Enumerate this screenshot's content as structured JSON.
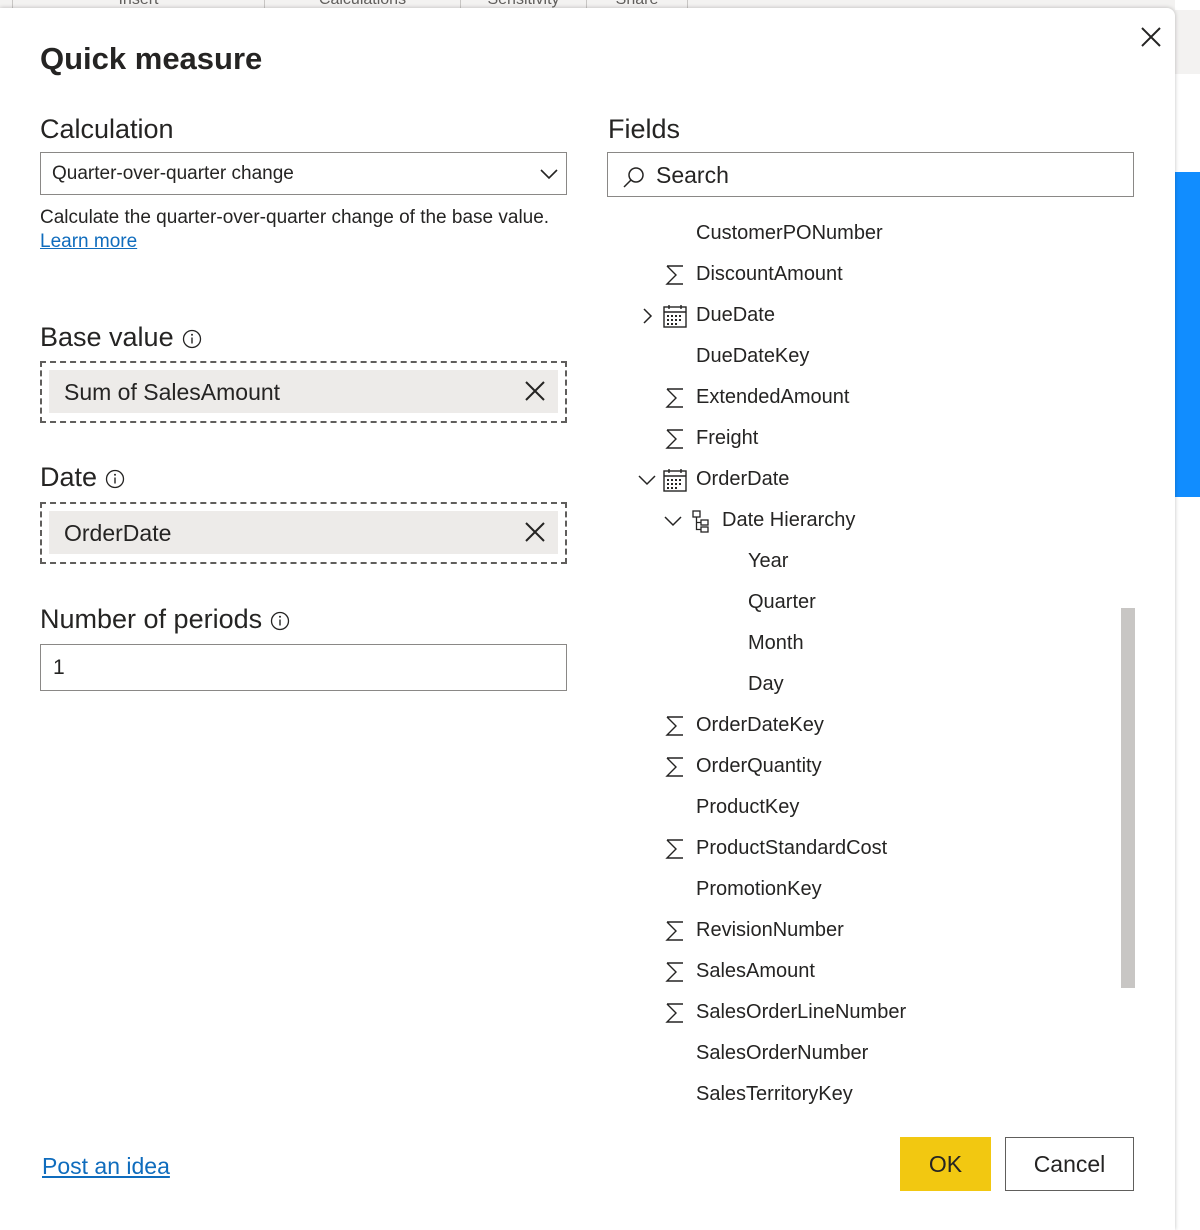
{
  "ribbon": {
    "tabs": [
      "Insert",
      "Calculations",
      "Sensitivity",
      "Share"
    ]
  },
  "dialog": {
    "title": "Quick measure",
    "calculation": {
      "label": "Calculation",
      "selected": "Quarter-over-quarter change",
      "description": "Calculate the quarter-over-quarter change of the base value.",
      "learn_more": "Learn more"
    },
    "base_value": {
      "label": "Base value",
      "chip": "Sum of SalesAmount"
    },
    "date": {
      "label": "Date",
      "chip": "OrderDate"
    },
    "periods": {
      "label": "Number of periods",
      "value": "1"
    },
    "fields": {
      "label": "Fields",
      "search_placeholder": "Search",
      "items": [
        {
          "label": "CustomerPONumber",
          "icon": "none"
        },
        {
          "label": "DiscountAmount",
          "icon": "sigma-icon"
        },
        {
          "label": "DueDate",
          "icon": "calendar-icon",
          "expand": "collapsed"
        },
        {
          "label": "DueDateKey",
          "icon": "none"
        },
        {
          "label": "ExtendedAmount",
          "icon": "sigma-icon"
        },
        {
          "label": "Freight",
          "icon": "sigma-icon"
        },
        {
          "label": "OrderDate",
          "icon": "calendar-icon",
          "expand": "expanded"
        },
        {
          "label": "Date Hierarchy",
          "icon": "hierarchy-icon",
          "expand": "expanded"
        },
        {
          "label": "Year",
          "icon": "none"
        },
        {
          "label": "Quarter",
          "icon": "none"
        },
        {
          "label": "Month",
          "icon": "none"
        },
        {
          "label": "Day",
          "icon": "none"
        },
        {
          "label": "OrderDateKey",
          "icon": "sigma-icon"
        },
        {
          "label": "OrderQuantity",
          "icon": "sigma-icon"
        },
        {
          "label": "ProductKey",
          "icon": "none"
        },
        {
          "label": "ProductStandardCost",
          "icon": "sigma-icon"
        },
        {
          "label": "PromotionKey",
          "icon": "none"
        },
        {
          "label": "RevisionNumber",
          "icon": "sigma-icon"
        },
        {
          "label": "SalesAmount",
          "icon": "sigma-icon"
        },
        {
          "label": "SalesOrderLineNumber",
          "icon": "sigma-icon"
        },
        {
          "label": "SalesOrderNumber",
          "icon": "none"
        },
        {
          "label": "SalesTerritoryKey",
          "icon": "none"
        }
      ]
    },
    "footer": {
      "post_idea": "Post an idea",
      "ok": "OK",
      "cancel": "Cancel"
    }
  },
  "colors": {
    "accent_yellow": "#f2c811",
    "link_blue": "#0f6cbd",
    "side_blue": "#118dff"
  }
}
